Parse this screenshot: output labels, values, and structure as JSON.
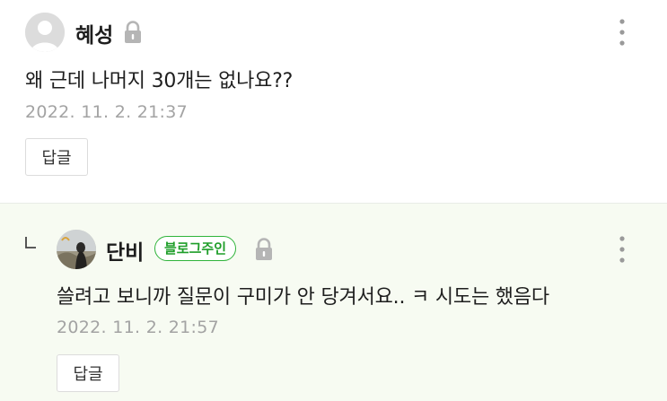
{
  "comments": [
    {
      "author": "혜성",
      "text": "왜 근데 나머지 30개는 없나요??",
      "date": "2022. 11. 2. 21:37",
      "reply_label": "답글"
    },
    {
      "author": "단비",
      "badge": "블로그주인",
      "text": "쓸려고 보니까 질문이 구미가 안 당겨서요.. ㅋ 시도는 했음다",
      "date": "2022. 11. 2. 21:57",
      "reply_label": "답글"
    }
  ],
  "icons": {
    "avatar_default": "default-user-avatar",
    "lock": "lock-icon",
    "more": "more-vertical-icon",
    "reply_arrow": "reply-arrow-icon"
  },
  "colors": {
    "reply_background": "#f7fbf2",
    "owner_badge": "#2fb43a",
    "date_text": "#a3a3a3"
  }
}
